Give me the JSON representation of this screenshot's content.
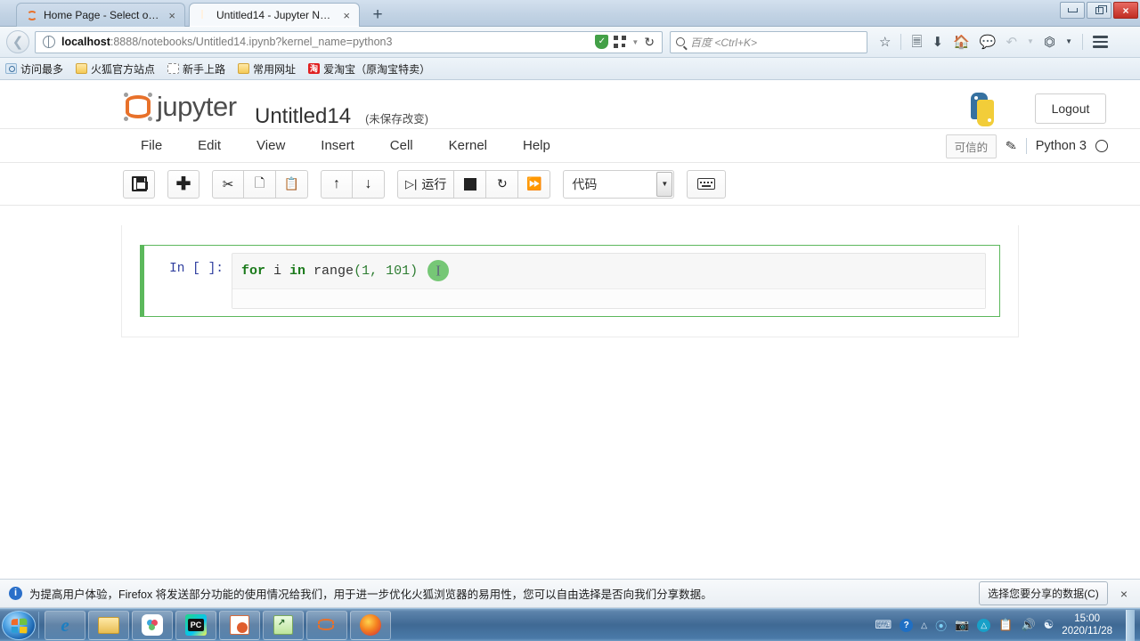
{
  "browser": {
    "tabs": [
      {
        "title": "Home Page - Select or c...",
        "icon": "jupyter-favicon",
        "active": false
      },
      {
        "title": "Untitled14 - Jupyter Not...",
        "icon": "notebook-favicon",
        "active": true
      }
    ],
    "newtab_label": "+",
    "close_label": "×",
    "window_controls": {
      "minimize": "minimize",
      "restore": "restore",
      "close": "×"
    },
    "url": {
      "host": "localhost",
      "rest": ":8888/notebooks/Untitled14.ipynb?kernel_name=python3"
    },
    "search_placeholder": "百度 <Ctrl+K>",
    "nav_icons": [
      "back-icon",
      "shield-icon",
      "qr-icon",
      "reload-icon",
      "bookmark-star-icon",
      "reading-list-icon",
      "download-icon",
      "home-icon",
      "chat-icon",
      "undo-icon",
      "screenshot-icon",
      "menu-icon"
    ],
    "bookmarks": [
      {
        "label": "访问最多",
        "icon": "most-visited-icon"
      },
      {
        "label": "火狐官方站点",
        "icon": "folder-icon"
      },
      {
        "label": "新手上路",
        "icon": "dashed-folder-icon"
      },
      {
        "label": "常用网址",
        "icon": "folder-icon"
      },
      {
        "label": "爱淘宝（原淘宝特卖）",
        "icon": "taobao-icon",
        "badge": "淘"
      }
    ]
  },
  "jupyter": {
    "brand": "jupyter",
    "notebook_name": "Untitled14",
    "save_status": "(未保存改变)",
    "logout_label": "Logout",
    "menus": [
      "File",
      "Edit",
      "View",
      "Insert",
      "Cell",
      "Kernel",
      "Help"
    ],
    "trusted_label": "可信的",
    "kernel_name": "Python 3",
    "toolbar": {
      "groups": [
        [
          {
            "name": "save-button",
            "icon": "save-icon",
            "label": ""
          }
        ],
        [
          {
            "name": "insert-cell-below-button",
            "icon": "plus-icon",
            "label": ""
          }
        ],
        [
          {
            "name": "cut-cell-button",
            "icon": "scissors-icon",
            "label": ""
          },
          {
            "name": "copy-cell-button",
            "icon": "copy-icon",
            "label": ""
          },
          {
            "name": "paste-cell-button",
            "icon": "paste-icon",
            "label": ""
          }
        ],
        [
          {
            "name": "move-cell-up-button",
            "icon": "arrow-up-icon",
            "label": ""
          },
          {
            "name": "move-cell-down-button",
            "icon": "arrow-down-icon",
            "label": ""
          }
        ],
        [
          {
            "name": "run-cell-button",
            "icon": "run-icon",
            "label": "运行"
          },
          {
            "name": "interrupt-kernel-button",
            "icon": "stop-icon",
            "label": ""
          },
          {
            "name": "restart-kernel-button",
            "icon": "restart-icon",
            "label": ""
          },
          {
            "name": "restart-and-run-all-button",
            "icon": "fast-forward-icon",
            "label": ""
          }
        ]
      ],
      "cell_type_value": "代码",
      "command_palette": "keyboard-icon"
    },
    "cell": {
      "prompt": "In [ ]:",
      "code_tokens": [
        {
          "t": "for",
          "c": "kw"
        },
        {
          "t": " i ",
          "c": "plain"
        },
        {
          "t": "in",
          "c": "kw"
        },
        {
          "t": " range",
          "c": "fn"
        },
        {
          "t": "(",
          "c": "paren"
        },
        {
          "t": "1",
          "c": "num"
        },
        {
          "t": ", ",
          "c": "paren"
        },
        {
          "t": "101",
          "c": "num"
        },
        {
          "t": ")",
          "c": "paren"
        }
      ],
      "code_text": "for i in range(1, 101)",
      "cursor_marker": "I"
    }
  },
  "notification": {
    "text": "为提高用户体验，Firefox 将发送部分功能的使用情况给我们，用于进一步优化火狐浏览器的易用性，您可以自由选择是否向我们分享数据。",
    "button_label": "选择您要分享的数据(C)",
    "close_label": "×"
  },
  "taskbar": {
    "start": "start-orb-icon",
    "items": [
      {
        "name": "taskbar-internet-explorer",
        "icon": "ie-icon"
      },
      {
        "name": "taskbar-file-explorer",
        "icon": "folder-icon"
      },
      {
        "name": "taskbar-cloud-app",
        "icon": "cloud-app-icon"
      },
      {
        "name": "taskbar-pycharm",
        "icon": "pycharm-icon",
        "label": "PC"
      },
      {
        "name": "taskbar-powerpoint",
        "icon": "powerpoint-icon"
      },
      {
        "name": "taskbar-notepadpp",
        "icon": "notepadpp-icon"
      },
      {
        "name": "taskbar-jupyter",
        "icon": "jupyter-icon"
      },
      {
        "name": "taskbar-firefox",
        "icon": "firefox-icon"
      }
    ],
    "tray": [
      "keyboard-icon",
      "help-icon",
      "expand-icon",
      "cloud-sync-icon",
      "camera-icon",
      "antivirus-icon",
      "clipboard-icon",
      "volume-icon",
      "network-icon"
    ],
    "time": "15:00",
    "date": "2020/11/28"
  }
}
